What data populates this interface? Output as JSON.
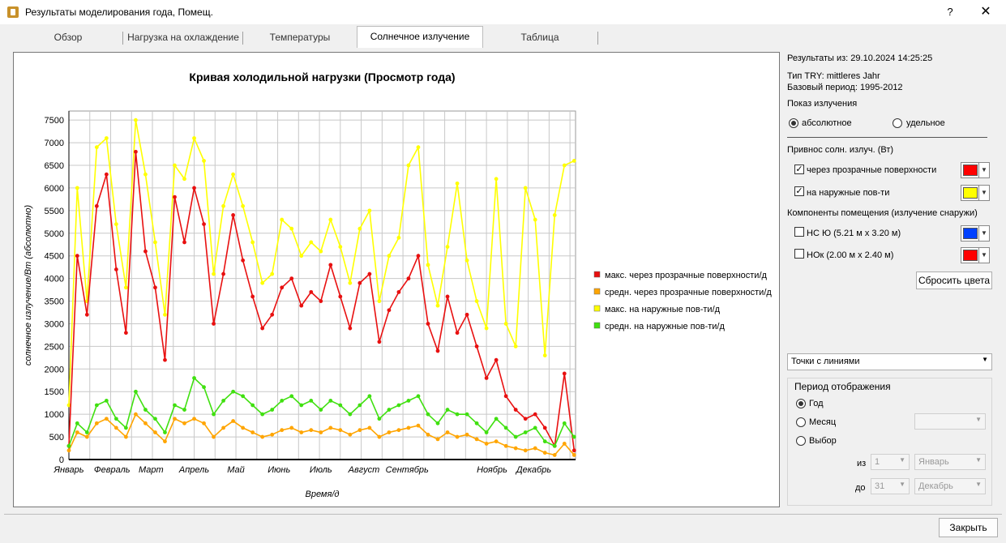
{
  "window": {
    "title": "Результаты моделирования года, Помещ.",
    "help": "?",
    "close": "✕"
  },
  "tabs": [
    "Обзор",
    "Нагрузка на охлаждение",
    "Температуры",
    "Солнечное излучение",
    "Таблица"
  ],
  "active_tab": "Солнечное излучение",
  "right": {
    "results_from": "Результаты из: 29.10.2024 14:25:25",
    "try_type": "Тип TRY: mittleres Jahr",
    "base_period": "Базовый период: 1995-2012",
    "display_label": "Показ излучения",
    "radio_absolute": "абсолютное",
    "radio_specific": "удельное",
    "solar_gain_label": "Привнос солн. излуч. (Вт)",
    "through_transparent": "через прозрачные поверхности",
    "on_exterior": "на наружные пов-ти",
    "components_label": "Компоненты помещения (излучение снаружи)",
    "component_1": "НС Ю (5.21 м x 3.20 м)",
    "component_2": "НОк (2.00 м x 2.40 м)",
    "reset_colors": "Сбросить цвета",
    "chart_style": "Точки с линиями",
    "period_title": "Период отображения",
    "period_year": "Год",
    "period_month": "Месяц",
    "period_select": "Выбор",
    "from_label": "из",
    "to_label": "до",
    "from_day": "1",
    "from_month": "Январь",
    "to_day": "31",
    "to_month": "Декабрь"
  },
  "close_button": "Закрыть",
  "colors": {
    "transparent": "#ff0000",
    "exterior": "#ffff00",
    "component_1": "#0040ff",
    "component_2": "#ff0000",
    "max_transparent": "#e81010",
    "avg_transparent": "#ffa500",
    "max_exterior": "#ffff00",
    "avg_exterior": "#40e010"
  },
  "chart_data": {
    "type": "line",
    "title": "Кривая холодильной нагрузки (Просмотр года)",
    "xlabel": "Время/д",
    "ylabel": "солнечное излучение/Вт (абсолютно)",
    "ylim": [
      0,
      7700
    ],
    "xlim": [
      1,
      365
    ],
    "yticks": [
      0,
      500,
      1000,
      1500,
      2000,
      2500,
      3000,
      3500,
      4000,
      4500,
      5000,
      5500,
      6000,
      6500,
      7000,
      7500
    ],
    "month_ticks": [
      {
        "label": "Январь",
        "day": 1
      },
      {
        "label": "Февраль",
        "day": 32
      },
      {
        "label": "Март",
        "day": 60
      },
      {
        "label": "Апрель",
        "day": 91
      },
      {
        "label": "Май",
        "day": 121
      },
      {
        "label": "Июнь",
        "day": 152
      },
      {
        "label": "Июль",
        "day": 182
      },
      {
        "label": "Август",
        "day": 213
      },
      {
        "label": "Сентябрь",
        "day": 244
      },
      {
        "label": "Ноябрь",
        "day": 305
      },
      {
        "label": "Декабрь",
        "day": 335
      }
    ],
    "legend_position": "right",
    "grid": true,
    "series": [
      {
        "name": "макс. через прозрачные поверхности/д",
        "color": "#e81010",
        "x": [
          1,
          7,
          14,
          21,
          28,
          35,
          42,
          49,
          56,
          63,
          70,
          77,
          84,
          91,
          98,
          105,
          112,
          119,
          126,
          133,
          140,
          147,
          154,
          161,
          168,
          175,
          182,
          189,
          196,
          203,
          210,
          217,
          224,
          231,
          238,
          245,
          252,
          259,
          266,
          273,
          280,
          287,
          294,
          301,
          308,
          315,
          322,
          329,
          336,
          343,
          350,
          357,
          364
        ],
        "values": [
          300,
          4500,
          3200,
          5600,
          6300,
          4200,
          2800,
          6800,
          4600,
          3800,
          2200,
          5800,
          4800,
          6000,
          5200,
          3000,
          4100,
          5400,
          4400,
          3600,
          2900,
          3200,
          3800,
          4000,
          3400,
          3700,
          3500,
          4300,
          3600,
          2900,
          3900,
          4100,
          2600,
          3300,
          3700,
          4000,
          4500,
          3000,
          2400,
          3600,
          2800,
          3200,
          2500,
          1800,
          2200,
          1400,
          1100,
          900,
          1000,
          700,
          300,
          1900,
          200
        ]
      },
      {
        "name": "средн. через прозрачные поверхности/д",
        "color": "#ffa500",
        "x": [
          1,
          7,
          14,
          21,
          28,
          35,
          42,
          49,
          56,
          63,
          70,
          77,
          84,
          91,
          98,
          105,
          112,
          119,
          126,
          133,
          140,
          147,
          154,
          161,
          168,
          175,
          182,
          189,
          196,
          203,
          210,
          217,
          224,
          231,
          238,
          245,
          252,
          259,
          266,
          273,
          280,
          287,
          294,
          301,
          308,
          315,
          322,
          329,
          336,
          343,
          350,
          357,
          364
        ],
        "values": [
          200,
          600,
          500,
          800,
          900,
          700,
          500,
          1000,
          800,
          600,
          400,
          900,
          800,
          900,
          800,
          500,
          700,
          850,
          700,
          600,
          500,
          550,
          650,
          700,
          600,
          650,
          600,
          700,
          650,
          550,
          650,
          700,
          500,
          600,
          650,
          700,
          750,
          550,
          450,
          600,
          500,
          550,
          450,
          350,
          400,
          300,
          250,
          200,
          250,
          150,
          100,
          350,
          100
        ]
      },
      {
        "name": "макс. на наружные пов-ти/д",
        "color": "#ffff00",
        "x": [
          1,
          7,
          14,
          21,
          28,
          35,
          42,
          49,
          56,
          63,
          70,
          77,
          84,
          91,
          98,
          105,
          112,
          119,
          126,
          133,
          140,
          147,
          154,
          161,
          168,
          175,
          182,
          189,
          196,
          203,
          210,
          217,
          224,
          231,
          238,
          245,
          252,
          259,
          266,
          273,
          280,
          287,
          294,
          301,
          308,
          315,
          322,
          329,
          336,
          343,
          350,
          357,
          364
        ],
        "values": [
          1200,
          6000,
          3500,
          6900,
          7100,
          5200,
          3800,
          7500,
          6300,
          4800,
          3200,
          6500,
          6200,
          7100,
          6600,
          4100,
          5600,
          6300,
          5600,
          4800,
          3900,
          4100,
          5300,
          5100,
          4500,
          4800,
          4600,
          5300,
          4700,
          3900,
          5100,
          5500,
          3500,
          4500,
          4900,
          6500,
          6900,
          4300,
          3400,
          4700,
          6100,
          4400,
          3500,
          2900,
          6200,
          3000,
          2500,
          6000,
          5300,
          2300,
          5400,
          6500,
          6600
        ]
      },
      {
        "name": "средн. на наружные пов-ти/д",
        "color": "#40e010",
        "x": [
          1,
          7,
          14,
          21,
          28,
          35,
          42,
          49,
          56,
          63,
          70,
          77,
          84,
          91,
          98,
          105,
          112,
          119,
          126,
          133,
          140,
          147,
          154,
          161,
          168,
          175,
          182,
          189,
          196,
          203,
          210,
          217,
          224,
          231,
          238,
          245,
          252,
          259,
          266,
          273,
          280,
          287,
          294,
          301,
          308,
          315,
          322,
          329,
          336,
          343,
          350,
          357,
          364
        ],
        "values": [
          300,
          800,
          600,
          1200,
          1300,
          900,
          700,
          1500,
          1100,
          900,
          600,
          1200,
          1100,
          1800,
          1600,
          1000,
          1300,
          1500,
          1400,
          1200,
          1000,
          1100,
          1300,
          1400,
          1200,
          1300,
          1100,
          1300,
          1200,
          1000,
          1200,
          1400,
          900,
          1100,
          1200,
          1300,
          1400,
          1000,
          800,
          1100,
          1000,
          1000,
          800,
          600,
          900,
          700,
          500,
          600,
          700,
          400,
          300,
          800,
          500
        ]
      }
    ]
  }
}
